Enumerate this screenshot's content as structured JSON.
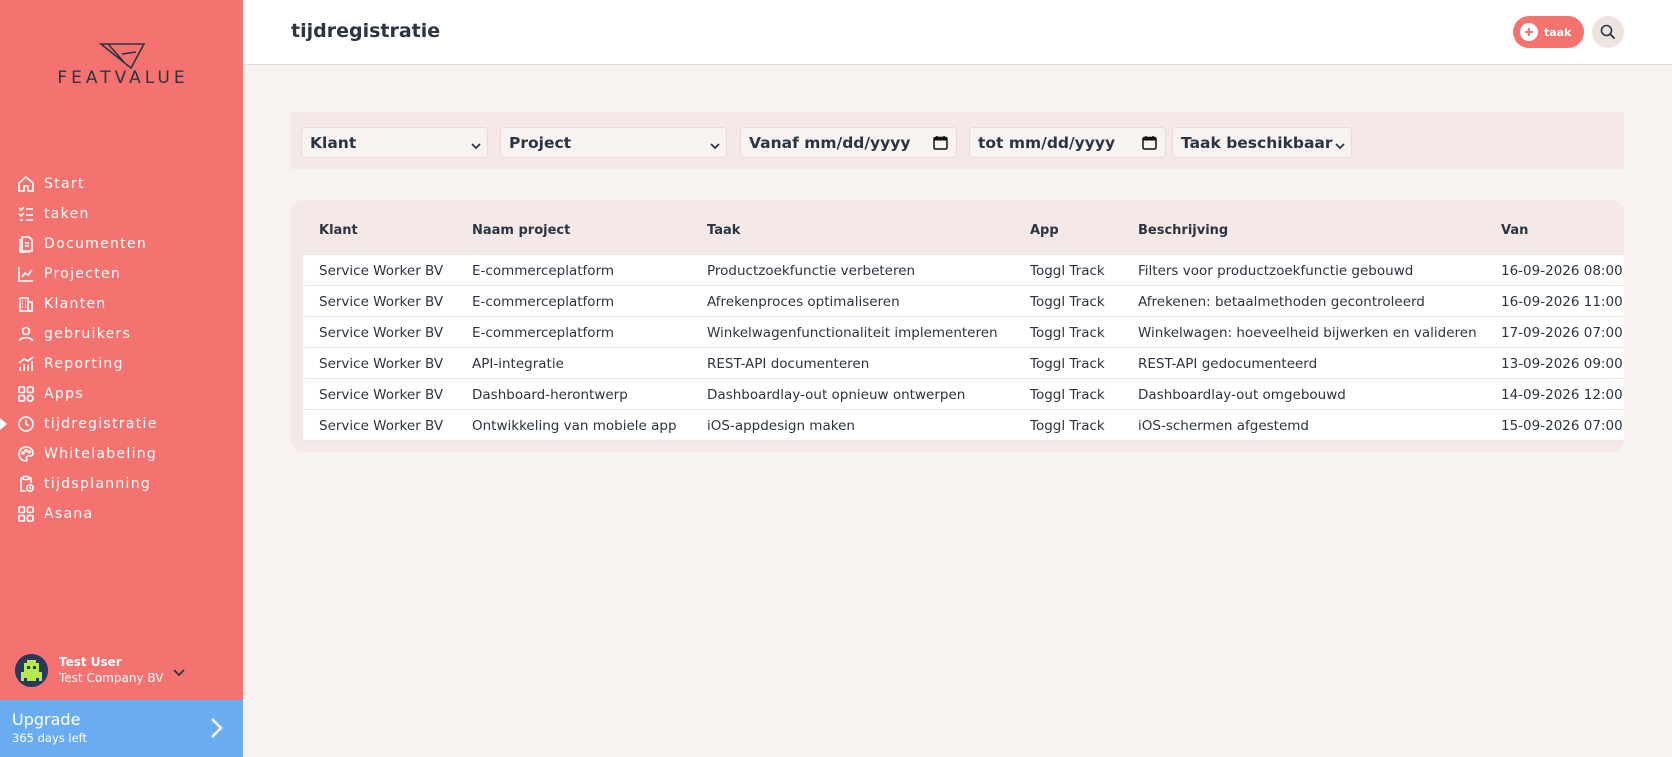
{
  "brand": {
    "name": "FEATVALUE"
  },
  "nav": [
    {
      "label": "Start",
      "icon": "home-icon"
    },
    {
      "label": "taken",
      "icon": "checklist-icon"
    },
    {
      "label": "Documenten",
      "icon": "documents-icon"
    },
    {
      "label": "Projecten",
      "icon": "projects-icon"
    },
    {
      "label": "Klanten",
      "icon": "building-icon"
    },
    {
      "label": "gebruikers",
      "icon": "user-icon"
    },
    {
      "label": "Reporting",
      "icon": "chart-icon"
    },
    {
      "label": "Apps",
      "icon": "apps-icon"
    },
    {
      "label": "tijdregistratie",
      "icon": "clock-icon",
      "active": true
    },
    {
      "label": "Whitelabeling",
      "icon": "palette-icon"
    },
    {
      "label": "tijdsplanning",
      "icon": "clipboard-clock-icon"
    },
    {
      "label": "Asana",
      "icon": "asana-icon"
    }
  ],
  "user": {
    "name": "Test User",
    "company": "Test Company BV"
  },
  "upgrade": {
    "title": "Upgrade",
    "subtitle": "365 days left"
  },
  "header": {
    "title": "tijdregistratie",
    "add_label": "taak"
  },
  "filters": {
    "client": "Klant",
    "project": "Project",
    "from": "Vanaf mm/dd/yyyy",
    "to": "tot mm/dd/yyyy",
    "task": "Taak beschikbaar"
  },
  "table": {
    "columns": [
      "Klant",
      "Naam project",
      "Taak",
      "App",
      "Beschrijving",
      "Van"
    ],
    "rows": [
      [
        "Service Worker BV",
        "E-commerceplatform",
        "Productzoekfunctie verbeteren",
        "Toggl Track",
        "Filters voor productzoekfunctie gebouwd",
        "16-09-2026 08:00"
      ],
      [
        "Service Worker BV",
        "E-commerceplatform",
        "Afrekenproces optimaliseren",
        "Toggl Track",
        "Afrekenen: betaalmethoden gecontroleerd",
        "16-09-2026 11:00"
      ],
      [
        "Service Worker BV",
        "E-commerceplatform",
        "Winkelwagenfunctionaliteit implementeren",
        "Toggl Track",
        "Winkelwagen: hoeveelheid bijwerken en valideren",
        "17-09-2026 07:00"
      ],
      [
        "Service Worker BV",
        "API-integratie",
        "REST-API documenteren",
        "Toggl Track",
        "REST-API gedocumenteerd",
        "13-09-2026 09:00"
      ],
      [
        "Service Worker BV",
        "Dashboard-herontwerp",
        "Dashboardlay-out opnieuw ontwerpen",
        "Toggl Track",
        "Dashboardlay-out omgebouwd",
        "14-09-2026 12:00"
      ],
      [
        "Service Worker BV",
        "Ontwikkeling van mobiele app",
        "iOS-appdesign maken",
        "Toggl Track",
        "iOS-schermen afgestemd",
        "15-09-2026 07:00"
      ]
    ]
  },
  "colors": {
    "sidebar": "#f47370",
    "accent": "#f47370",
    "upgrade": "#6aacf1",
    "text": "#2b3442"
  }
}
